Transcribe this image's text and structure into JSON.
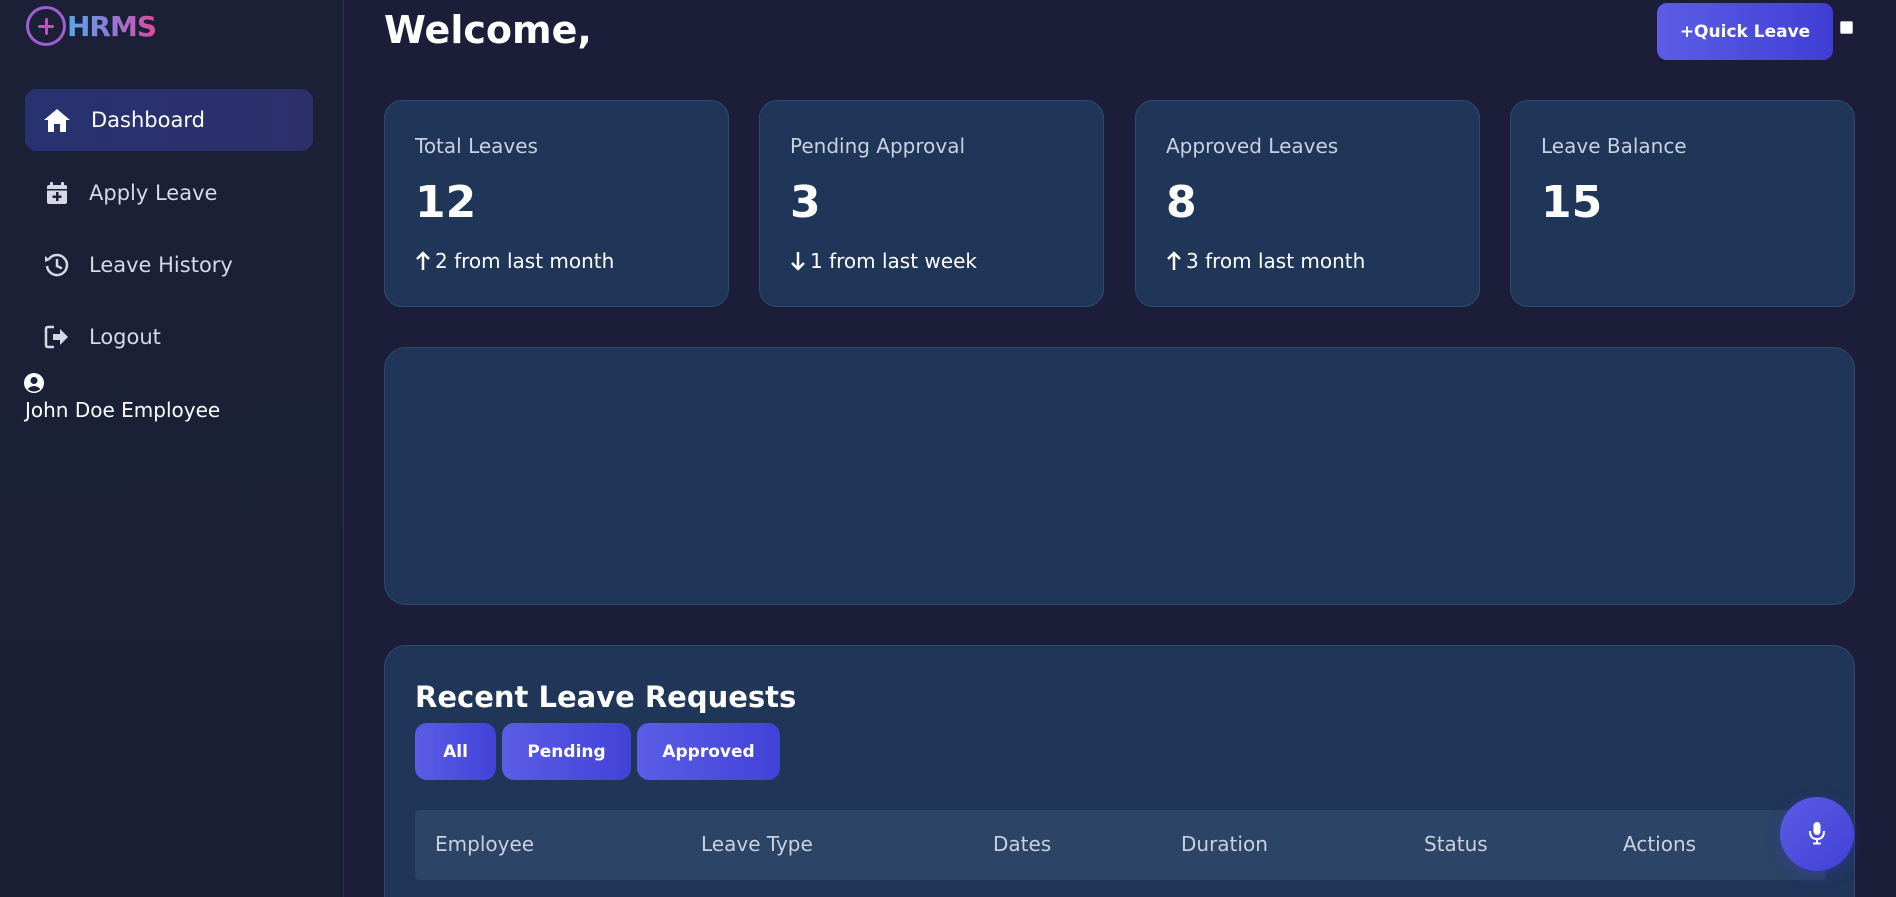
{
  "brand": {
    "logo_text": "HRMS"
  },
  "sidebar": {
    "items": [
      {
        "label": "Dashboard",
        "icon": "home-icon",
        "active": true
      },
      {
        "label": "Apply Leave",
        "icon": "calendar-plus-icon",
        "active": false
      },
      {
        "label": "Leave History",
        "icon": "history-icon",
        "active": false
      },
      {
        "label": "Logout",
        "icon": "logout-icon",
        "active": false
      }
    ],
    "user": {
      "icon": "user-circle-icon",
      "name": "John Doe Employee"
    }
  },
  "header": {
    "welcome": "Welcome,",
    "quick_leave_label": "+Quick Leave"
  },
  "stats": [
    {
      "label": "Total Leaves",
      "value": "12",
      "delta": "2 from last month",
      "direction": "up"
    },
    {
      "label": "Pending Approval",
      "value": "3",
      "delta": "1 from last week",
      "direction": "down"
    },
    {
      "label": "Approved Leaves",
      "value": "8",
      "delta": "3 from last month",
      "direction": "up"
    },
    {
      "label": "Leave Balance",
      "value": "15",
      "delta": "",
      "direction": ""
    }
  ],
  "recent_requests": {
    "title": "Recent Leave Requests",
    "filters": [
      "All",
      "Pending",
      "Approved"
    ],
    "columns": [
      "Employee",
      "Leave Type",
      "Dates",
      "Duration",
      "Status",
      "Actions"
    ]
  },
  "colors": {
    "background": "#1c1d38",
    "card": "#1f3659",
    "accent": "#4f4fdf",
    "sidebar_active": "#273270"
  }
}
